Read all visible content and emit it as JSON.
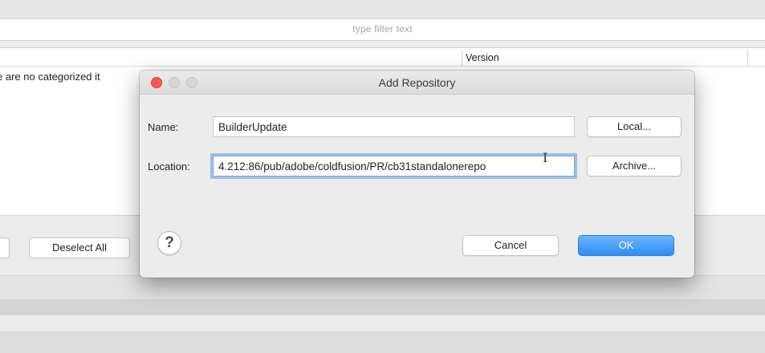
{
  "background": {
    "filter_placeholder": "type filter text",
    "table": {
      "column_version": "Version",
      "empty_message": "e are no categorized it"
    },
    "deselect_all_label": "Deselect All"
  },
  "dialog": {
    "title": "Add Repository",
    "name_label": "Name:",
    "name_value": "BuilderUpdate",
    "location_label": "Location:",
    "location_value": "4.212:86/pub/adobe/coldfusion/PR/cb31standalonerepo",
    "local_button": "Local...",
    "archive_button": "Archive...",
    "help_glyph": "?",
    "cancel_button": "Cancel",
    "ok_button": "OK"
  },
  "colors": {
    "close_light": "#fc5753",
    "ok_button": "#2f8ef5",
    "focus_ring": "#5d97e5"
  }
}
